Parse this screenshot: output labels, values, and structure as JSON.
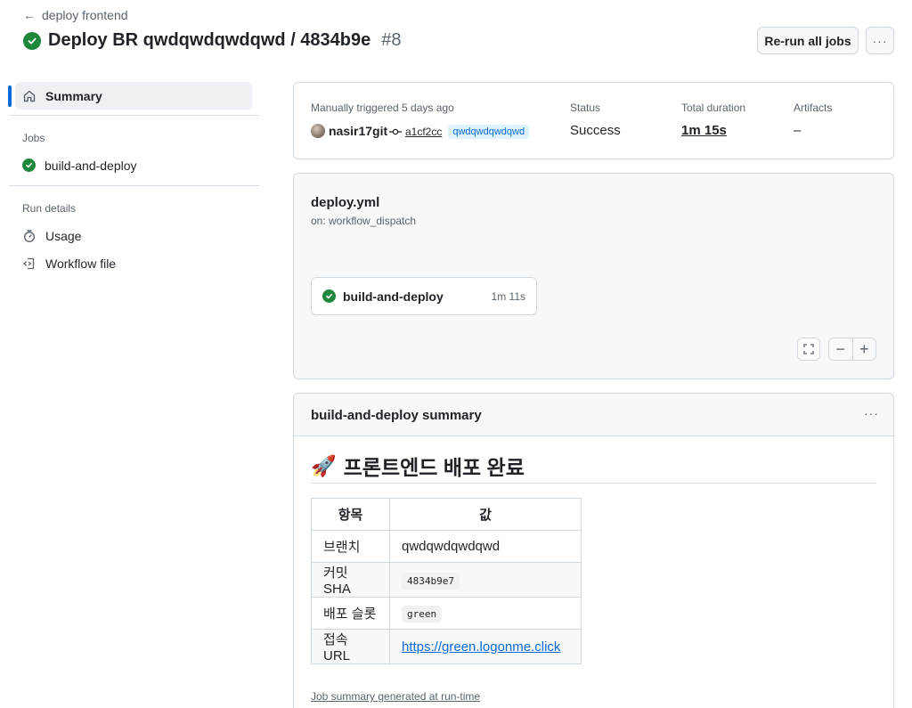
{
  "header": {
    "back_label": "deploy frontend",
    "title": "Deploy BR qwdqwdqwdqwd / 4834b9e",
    "run_number": "#8",
    "rerun_label": "Re-run all jobs",
    "more_label": "···"
  },
  "sidebar": {
    "summary_label": "Summary",
    "jobs_heading": "Jobs",
    "job_label": "build-and-deploy",
    "run_details_heading": "Run details",
    "usage_label": "Usage",
    "workflow_file_label": "Workflow file"
  },
  "run_info": {
    "trigger_label": "Manually triggered 5 days ago",
    "actor": "nasir17git",
    "commit_sha": "a1cf2cc",
    "branch": "qwdqwdqwdqwd",
    "status_label": "Status",
    "status_value": "Success",
    "duration_label": "Total duration",
    "duration_value": "1m 15s",
    "artifacts_label": "Artifacts",
    "artifacts_value": "–"
  },
  "graph": {
    "workflow_file": "deploy.yml",
    "trigger": "on: workflow_dispatch",
    "job_name": "build-and-deploy",
    "job_duration": "1m 11s",
    "zoom_out": "−",
    "zoom_in": "+"
  },
  "summary": {
    "title": "build-and-deploy summary",
    "more_label": "···",
    "heading_emoji": "🚀",
    "heading": "프론트엔드 배포 완료",
    "table": {
      "headers": [
        "항목",
        "값"
      ],
      "rows": [
        [
          "브랜치",
          "qwdqwdqwdqwd"
        ],
        [
          "커밋 SHA",
          "4834b9e7"
        ],
        [
          "배포 슬롯",
          "green"
        ],
        [
          "접속 URL",
          "https://green.logonme.click"
        ]
      ]
    },
    "footer": "Job summary generated at run-time"
  },
  "colors": {
    "success": "#1f883d",
    "accent": "#0969da",
    "border": "#d1d9e0",
    "muted_bg": "#f6f8fa"
  },
  "icons": [
    "arrow-left-icon",
    "check-circle-icon",
    "home-icon",
    "stopwatch-icon",
    "workflow-file-icon",
    "commit-icon",
    "fullscreen-icon",
    "rocket-icon",
    "kebab-icon"
  ]
}
